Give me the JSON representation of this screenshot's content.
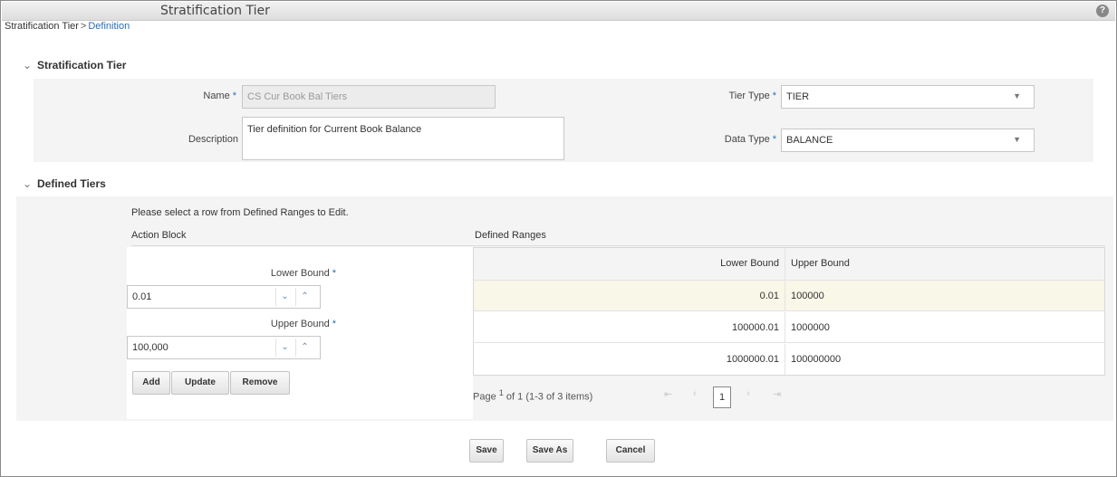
{
  "window": {
    "title": "Stratification Tier"
  },
  "breadcrumb": {
    "root": "Stratification Tier",
    "separator": ">",
    "current": "Definition"
  },
  "section_tier": {
    "heading": "Stratification Tier",
    "name_label": "Name",
    "name_value": "CS Cur Book Bal Tiers",
    "description_label": "Description",
    "description_value": "Tier definition for Current Book Balance",
    "tier_type_label": "Tier Type",
    "tier_type_value": "TIER",
    "data_type_label": "Data Type",
    "data_type_value": "BALANCE",
    "required_mark": "*"
  },
  "section_defined": {
    "heading": "Defined Tiers",
    "note": "Please select a row from Defined Ranges to Edit.",
    "action_block_label": "Action Block",
    "lower_bound_label": "Lower Bound",
    "lower_bound_value": "0.01",
    "upper_bound_label": "Upper Bound",
    "upper_bound_value": "100,000",
    "buttons": {
      "add": "Add",
      "update": "Update",
      "remove": "Remove"
    },
    "ranges_label": "Defined Ranges",
    "columns": [
      "Lower Bound",
      "Upper Bound"
    ],
    "rows": [
      {
        "lower": "0.01",
        "upper": "100000"
      },
      {
        "lower": "100000.01",
        "upper": "1000000"
      },
      {
        "lower": "1000000.01",
        "upper": "100000000"
      }
    ],
    "pager": {
      "page_label": "Page",
      "page_num": "1",
      "of_label": "of 1",
      "items": "(1-3 of 3 items)",
      "current": "1"
    }
  },
  "footer": {
    "save": "Save",
    "save_as": "Save As",
    "cancel": "Cancel"
  },
  "icons": {
    "help": "help-icon",
    "collapse": "chevron-down-icon"
  },
  "colors": {
    "link": "#2a6db5",
    "selected_row": "#f8f7e8",
    "panel": "#f4f4f4"
  }
}
